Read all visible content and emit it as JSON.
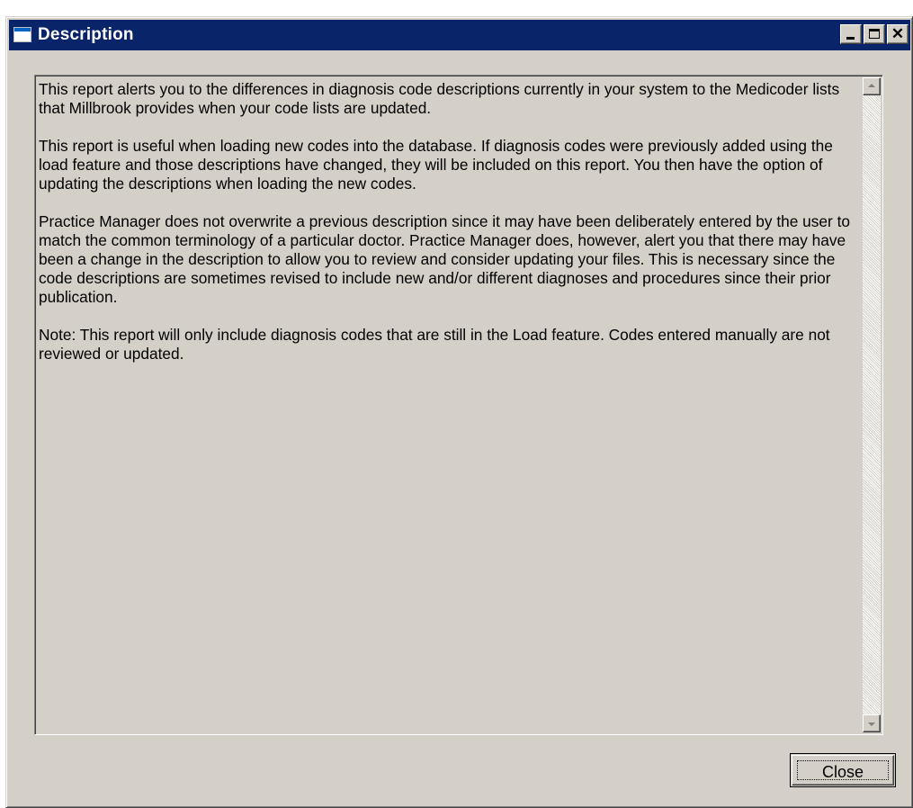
{
  "window": {
    "title": "Description",
    "controls": {
      "minimize": "minimize-icon",
      "maximize": "maximize-icon",
      "close": "close-icon"
    }
  },
  "description": {
    "paragraphs": [
      "This report alerts you to the differences in diagnosis code descriptions currently in your system to the Medicoder lists that Millbrook provides when your code lists are updated.",
      "This report is useful when loading new codes into the database. If diagnosis codes were previously added using the load feature and those descriptions have changed, they will be included on this report. You then have the option of updating the descriptions when loading the new codes.",
      "Practice Manager does not overwrite a previous description since it may have been deliberately entered by the user to match the common terminology of a particular doctor. Practice Manager does, however, alert you that there may have been a change in the description to allow you to review and consider updating your files. This is necessary since the code descriptions are sometimes revised to include new and/or different diagnoses and procedures since their prior publication.",
      "Note: This report will only include diagnosis codes that are still in the Load feature. Codes entered manually are not reviewed or updated."
    ]
  },
  "buttons": {
    "close_label": "Close"
  },
  "colors": {
    "titlebar": "#0a246a",
    "window_face": "#d4d0c8"
  }
}
